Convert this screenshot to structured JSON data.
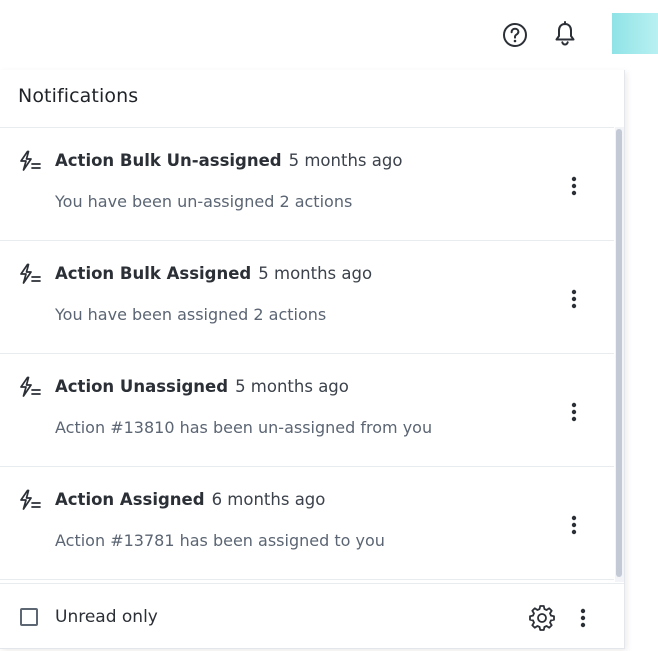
{
  "header": {
    "help_icon": "help-circle-icon",
    "bell_icon": "bell-icon",
    "accent_color": "#8fe3e6"
  },
  "panel": {
    "title": "Notifications",
    "items": [
      {
        "icon": "bolt-list-icon",
        "title": "Action Bulk Un-assigned",
        "time": "5 months ago",
        "body": "You have been un-assigned 2 actions"
      },
      {
        "icon": "bolt-list-icon",
        "title": "Action Bulk Assigned",
        "time": "5 months ago",
        "body": "You have been assigned 2 actions"
      },
      {
        "icon": "bolt-list-icon",
        "title": "Action Unassigned",
        "time": "5 months ago",
        "body": "Action #13810 has been un-assigned from you"
      },
      {
        "icon": "bolt-list-icon",
        "title": "Action Assigned",
        "time": "6 months ago",
        "body": "Action #13781 has been assigned to you"
      }
    ]
  },
  "footer": {
    "unread_only_label": "Unread only",
    "unread_only_checked": false,
    "settings_icon": "gear-icon",
    "more_icon": "kebab-icon"
  }
}
